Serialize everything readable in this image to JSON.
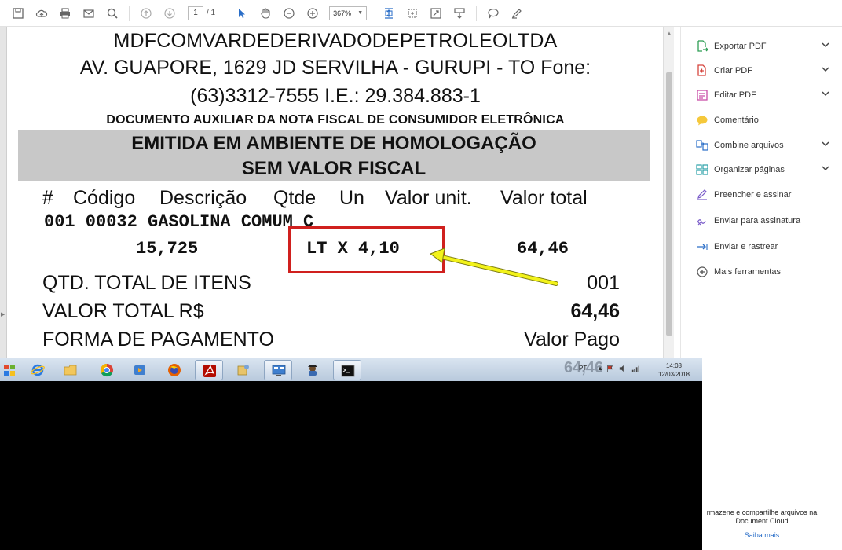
{
  "toolbar": {
    "page_current": "1",
    "page_total": "/ 1",
    "zoom": "367%"
  },
  "receipt": {
    "company": "MDFCOMVARDEDERIVADODEPETROLEOLTDA",
    "address": "AV. GUAPORE, 1629 JD SERVILHA - GURUPI - TO Fone:",
    "phone_ie": "(63)3312-7555 I.E.: 29.384.883-1",
    "doc_title": "DOCUMENTO AUXILIAR DA NOTA FISCAL DE CONSUMIDOR ELETRÔNICA",
    "banner_line1": "EMITIDA EM AMBIENTE DE HOMOLOGAÇÃO",
    "banner_line2": "SEM VALOR FISCAL",
    "columns": {
      "num": "#",
      "codigo": "Código",
      "descricao": "Descrição",
      "qtde": "Qtde",
      "un": "Un",
      "valor_unit": "Valor unit.",
      "valor_total": "Valor total"
    },
    "item_line": "001 00032 GASOLINA COMUM C",
    "item_qty": "15,725",
    "item_unit_price": "LT X 4,10",
    "item_total": "64,46",
    "qtd_label": "QTD. TOTAL DE ITENS",
    "qtd_value": "001",
    "valor_label": "VALOR TOTAL R$",
    "valor_value": "64,46",
    "forma_label": "FORMA DE PAGAMENTO",
    "forma_value": "Valor Pago"
  },
  "right_panel": {
    "items": [
      {
        "label": "Exportar PDF"
      },
      {
        "label": "Criar PDF"
      },
      {
        "label": "Editar PDF"
      },
      {
        "label": "Comentário"
      },
      {
        "label": "Combine arquivos"
      },
      {
        "label": "Organizar páginas"
      },
      {
        "label": "Preencher e assinar"
      },
      {
        "label": "Enviar para assinatura"
      },
      {
        "label": "Enviar e rastrear"
      },
      {
        "label": "Mais ferramentas"
      }
    ],
    "promo_line1": "rmazene e compartilhe arquivos na",
    "promo_line2": "Document Cloud",
    "promo_link": "Saiba mais"
  },
  "taskbar": {
    "lang": "PT",
    "time": "14:08",
    "date": "12/03/2018",
    "ghost": "64,46"
  },
  "colors": {
    "highlight_box": "#d0201e",
    "arrow": "#f2f21a",
    "banner": "#c8c8c8"
  }
}
